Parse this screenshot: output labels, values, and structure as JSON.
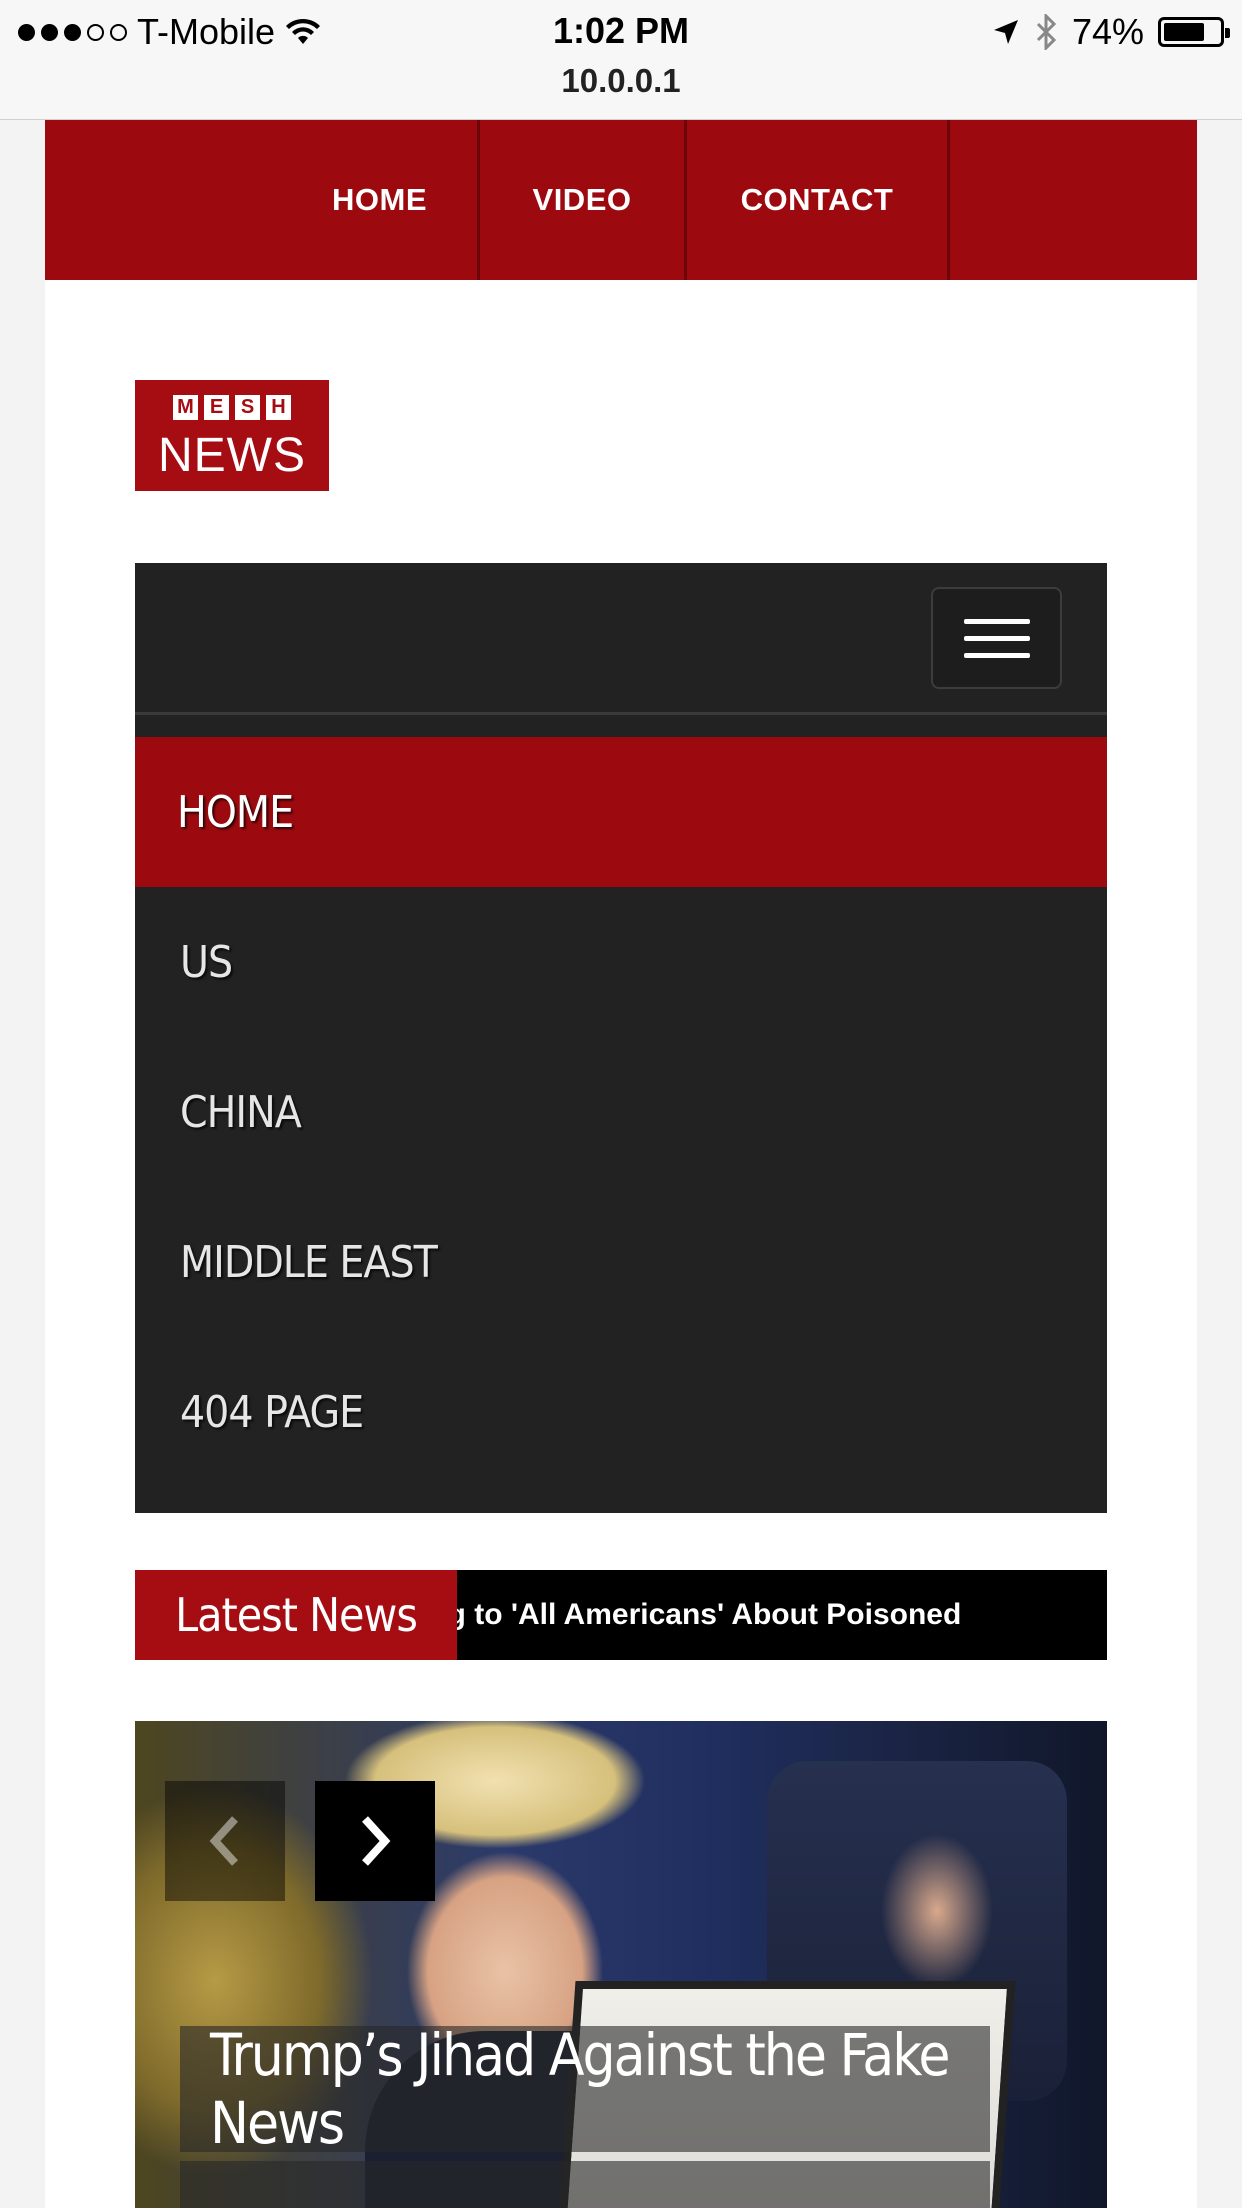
{
  "status_bar": {
    "carrier": "T-Mobile",
    "signal_bars": 3,
    "signal_total": 5,
    "time": "1:02 PM",
    "url": "10.0.0.1",
    "battery": "74%",
    "battery_level": 0.74
  },
  "top_nav": {
    "items": [
      {
        "label": "HOME"
      },
      {
        "label": "VIDEO"
      },
      {
        "label": "CONTACT"
      }
    ]
  },
  "logo": {
    "letters": [
      "M",
      "E",
      "S",
      "H"
    ],
    "word": "NEWS"
  },
  "menu": {
    "items": [
      {
        "label": "HOME",
        "active": true
      },
      {
        "label": "US"
      },
      {
        "label": "CHINA"
      },
      {
        "label": "MIDDLE EAST"
      },
      {
        "label": "404 PAGE"
      }
    ]
  },
  "ticker": {
    "label": "Latest News",
    "headline": "Warning to 'All Americans' About Poisoned"
  },
  "slider": {
    "caption": "Trump’s Jihad Against the Fake News"
  },
  "colors": {
    "brand_red": "#9c0a0f",
    "menu_dark": "#222222"
  }
}
